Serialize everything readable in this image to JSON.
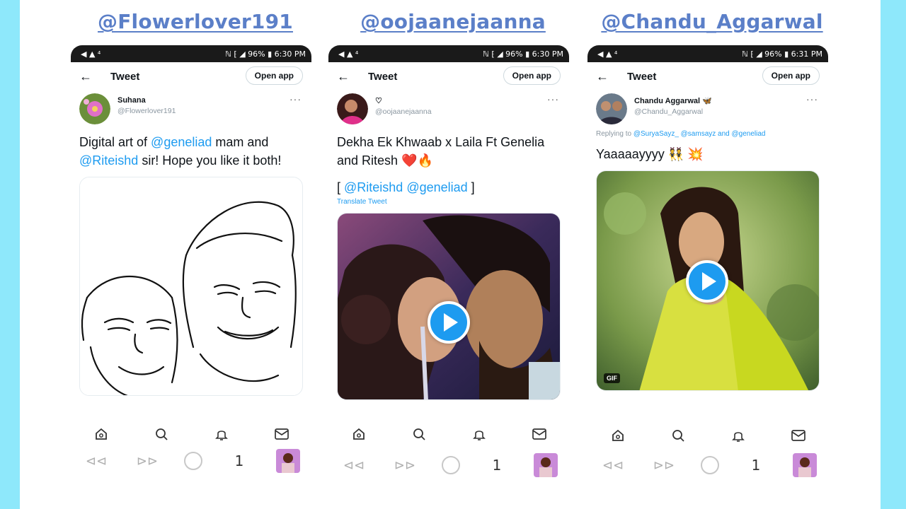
{
  "headers": [
    "@Flowerlover191",
    "@oojaanejaanna",
    "@Chandu_Aggarwal"
  ],
  "phones": [
    {
      "status_left": "◀ ▲ ⁴",
      "status_right": "ℕ ⁅ ◢ 96% ▮ 6:30 PM",
      "top_title": "Tweet",
      "open_app": "Open app",
      "display_name": "Suhana",
      "handle": "@Flowerlover191",
      "text_parts": [
        "Digital art of ",
        "@geneliad",
        " mam and ",
        "@Riteishd",
        " sir! Hope you like it both!"
      ]
    },
    {
      "status_left": "◀ ▲ ⁴",
      "status_right": "ℕ ⁅ ◢ 96% ▮ 6:30 PM",
      "top_title": "Tweet",
      "open_app": "Open app",
      "display_name": "♡",
      "handle": "@oojaanejaanna",
      "text_line1": "Dekha Ek Khwaab x Laila Ft Genelia and Ritesh ❤️🔥",
      "bracket_open": "[ ",
      "mention1": "@Riteishd",
      "mention2": " @geneliad",
      "bracket_close": " ]",
      "translate": "Translate Tweet"
    },
    {
      "status_left": "◀ ▲ ⁴",
      "status_right": "ℕ ⁅ ◢ 96% ▮ 6:31 PM",
      "top_title": "Tweet",
      "open_app": "Open app",
      "display_name": "Chandu Aggarwal 🦋",
      "handle": "@Chandu_Aggarwal",
      "reply_prefix": "Replying to ",
      "reply_mentions": "@SuryaSayz_ @samsayz and @geneliad",
      "text": "Yaaaaayyyy 👯 💥",
      "gif": "GIF"
    }
  ],
  "browser": {
    "back": "⊲⊲",
    "forward": "⊳⊳",
    "tab_count": "1"
  },
  "colors": {
    "accent": "#1d9bf0",
    "side_bar": "#8ee8fb",
    "header_text": "#5b7fc8"
  },
  "icons": [
    "home-icon",
    "search-icon",
    "bell-icon",
    "mail-icon",
    "back-icon",
    "forward-icon",
    "reload-icon",
    "tab-thumbnail-icon"
  ]
}
